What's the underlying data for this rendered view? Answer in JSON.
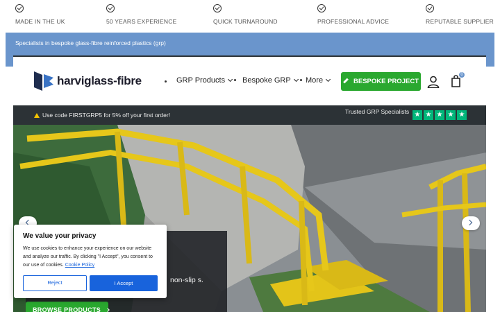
{
  "usp_bar": {
    "items": [
      {
        "label": "MADE IN THE UK",
        "icon": "check-circle-icon"
      },
      {
        "label": "50 YEARS EXPERIENCE",
        "icon": "check-circle-icon"
      },
      {
        "label": "QUICK TURNAROUND",
        "icon": "check-circle-icon"
      },
      {
        "label": "PROFESSIONAL ADVICE",
        "icon": "check-circle-icon"
      },
      {
        "label": "REPUTABLE SUPPLIER",
        "icon": "check-circle-icon"
      }
    ]
  },
  "tagline": "Specialists in bespoke glass-fibre reinforced plastics (grp)",
  "header": {
    "logo_text": "harviglass-fibre",
    "nav": [
      {
        "label": "GRP Products"
      },
      {
        "label": "Bespoke GRP"
      },
      {
        "label": "More"
      }
    ],
    "cta_label": "BESPOKE PROJECT",
    "cart_count": "0"
  },
  "promo": {
    "text": "Use code FIRSTGRP5 for 5% off your first order!",
    "trust_text": "Trusted GRP Specialists",
    "stars": 5
  },
  "hero": {
    "text": "non-slip s.",
    "browse_label": "BROWSE PRODUCTS"
  },
  "cookie": {
    "title": "We value your privacy",
    "body": "We use cookies to enhance your experience on our website and analyze our traffic. By clicking \"I Accept\", you consent to our use of cookies.",
    "policy_link": "Cookie Policy",
    "reject_label": "Reject",
    "accept_label": "I Accept"
  },
  "colors": {
    "accent_green": "#2aa82f",
    "brand_blue": "#6a95cc",
    "cookie_blue": "#1863dc",
    "trustpilot_green": "#00b67a"
  }
}
